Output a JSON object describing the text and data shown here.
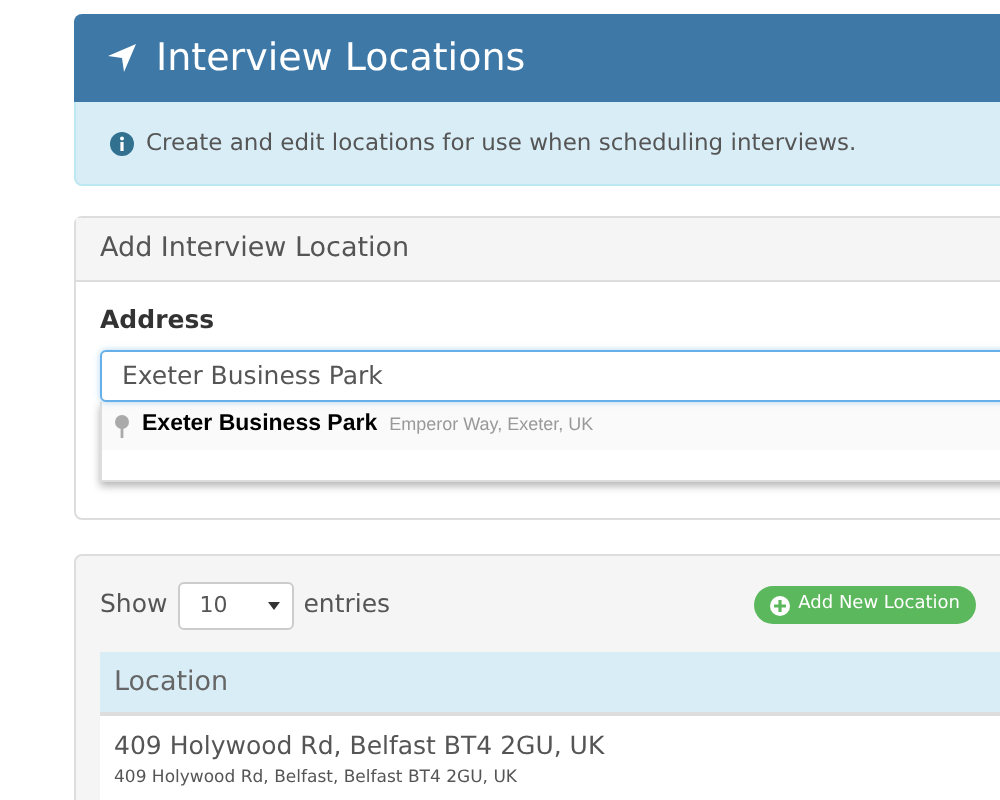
{
  "header": {
    "title": "Interview Locations"
  },
  "info": {
    "text": "Create and edit locations for use when scheduling interviews."
  },
  "add_panel": {
    "title": "Add Interview Location",
    "address_label": "Address",
    "address_value": "Exeter Business Park",
    "suggestions": [
      {
        "name": "Exeter Business Park",
        "detail": "Emperor Way, Exeter, UK"
      }
    ]
  },
  "list_panel": {
    "show_label": "Show",
    "page_size": "10",
    "entries_label": "entries",
    "add_button": "Add New Location",
    "table": {
      "columns": [
        "Location"
      ],
      "rows": [
        {
          "title": "409 Holywood Rd, Belfast BT4 2GU, UK",
          "subtitle": "409 Holywood Rd, Belfast, Belfast BT4 2GU, UK"
        }
      ]
    }
  }
}
